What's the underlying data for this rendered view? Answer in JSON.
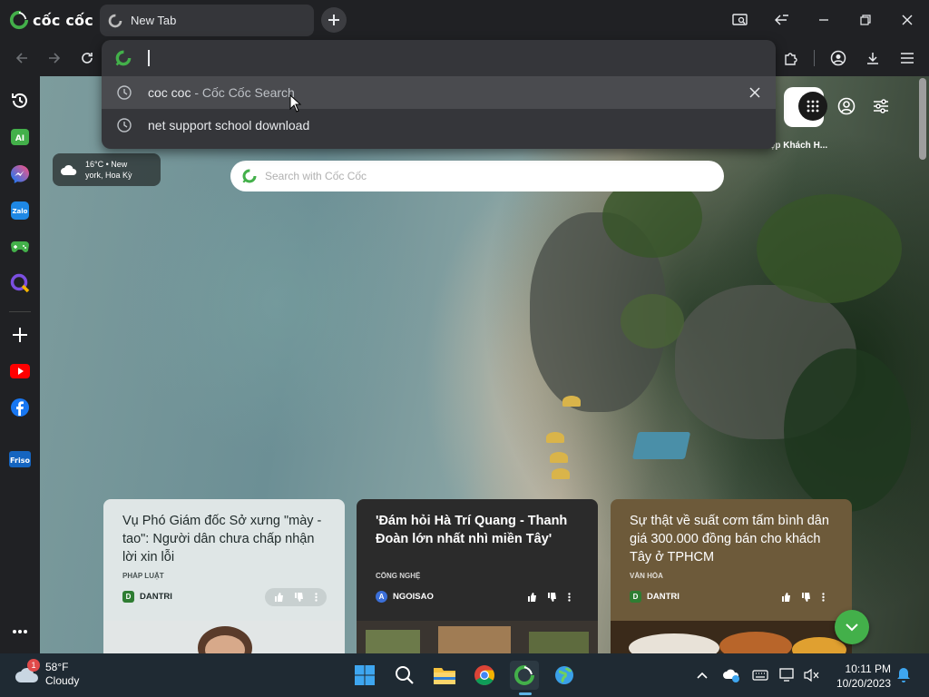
{
  "browser": {
    "brand": "cốc cốc",
    "tab_title": "New Tab"
  },
  "omnibox": {
    "input_value": "",
    "suggestions": [
      {
        "primary": "coc coc",
        "secondary": " - Cốc Cốc Search"
      },
      {
        "primary": "net support school download",
        "secondary": ""
      }
    ]
  },
  "sidebar": {
    "items": [
      "history-icon",
      "ai-icon",
      "messenger-icon",
      "zalo-icon",
      "gamepad-icon",
      "q-app-icon",
      "add-icon",
      "youtube-icon",
      "facebook-icon",
      "friso-icon",
      "more-icon"
    ]
  },
  "newtab": {
    "weather": {
      "line1": "16°C • New",
      "line2": "york, Hoa Kỳ"
    },
    "search_placeholder": "Search with Cốc Cốc",
    "tile_label": "iệp Khách H...",
    "cards": [
      {
        "title": "Vụ Phó Giám đốc Sở xưng \"mày - tao\": Người dân chưa chấp nhận lời xin lỗi",
        "category": "PHÁP LUẬT",
        "source": "DANTRI"
      },
      {
        "title": "'Đám hỏi Hà Trí Quang - Thanh Đoàn lớn nhất nhì miền Tây'",
        "category": "CÔNG NGHỆ",
        "source": "NGOISAO"
      },
      {
        "title": "Sự thật về suất cơm tấm bình dân giá 300.000 đồng bán cho khách Tây ở TPHCM",
        "category": "VĂN HÓA",
        "source": "DANTRI"
      }
    ]
  },
  "taskbar": {
    "weather_temp": "58°F",
    "weather_desc": "Cloudy",
    "weather_badge": "1",
    "time": "10:11 PM",
    "date": "10/20/2023"
  },
  "colors": {
    "brand_green": "#43b04a",
    "omnibox_bg": "#35363a",
    "taskbar_bg": "#1f2a33"
  }
}
